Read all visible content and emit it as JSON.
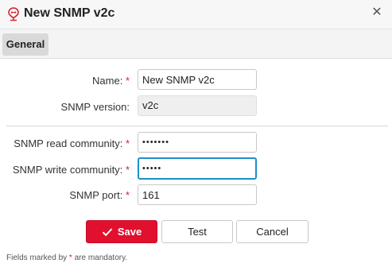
{
  "window": {
    "title": "New SNMP v2c",
    "icon": "snmp-network-icon",
    "close_icon": "close-icon",
    "close_glyph": "✕"
  },
  "tabs": [
    {
      "label": "General",
      "active": true
    }
  ],
  "form": {
    "name": {
      "label": "Name:",
      "required": "*",
      "value": "New SNMP v2c"
    },
    "snmp_version": {
      "label": "SNMP version:",
      "value": "v2c"
    },
    "read_community": {
      "label": "SNMP read community:",
      "required": "*",
      "value": "•••••••"
    },
    "write_community": {
      "label": "SNMP write community:",
      "required": "*",
      "value": "•••••"
    },
    "port": {
      "label": "SNMP port:",
      "required": "*",
      "value": "161"
    }
  },
  "buttons": {
    "save": "Save",
    "test": "Test",
    "cancel": "Cancel"
  },
  "footnote": {
    "before": "Fields marked by ",
    "star": "*",
    "after": " are mandatory."
  },
  "colors": {
    "accent": "#e0102e",
    "focus": "#1d8fcb",
    "required": "#d71e2b"
  }
}
